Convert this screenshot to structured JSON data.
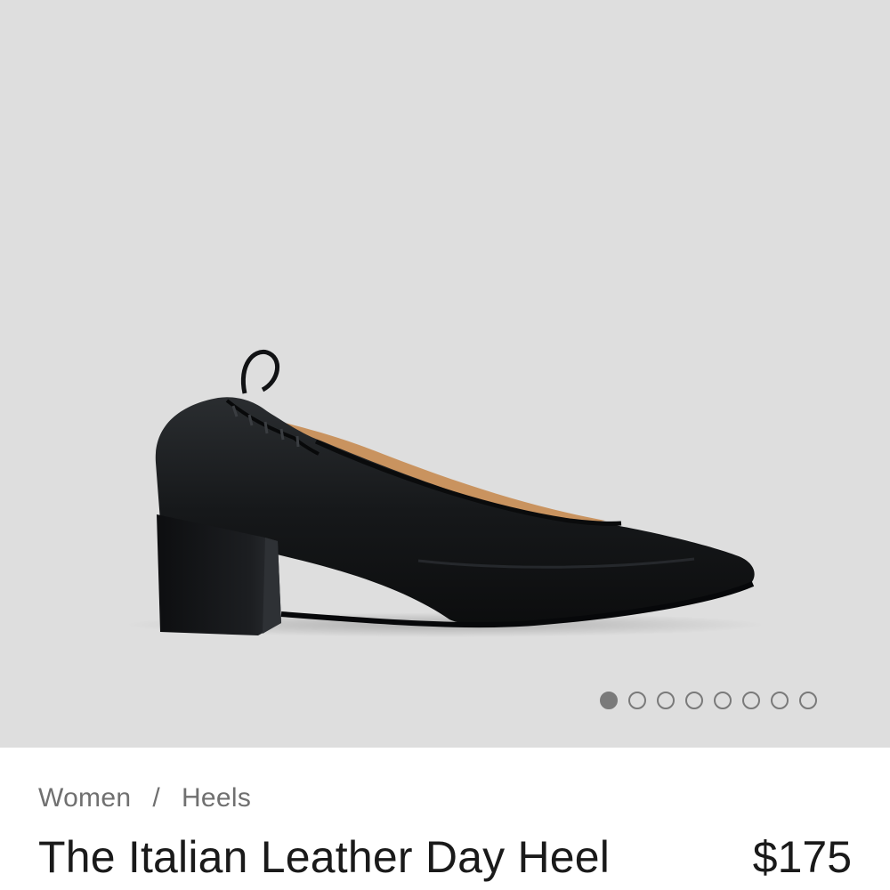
{
  "product_gallery": {
    "image_description": "black leather block heel pump",
    "image_count": 8,
    "active_index": 0
  },
  "breadcrumb": {
    "items": [
      "Women",
      "Heels"
    ],
    "separator": "/"
  },
  "product": {
    "title": "The Italian Leather Day Heel",
    "price": "$175"
  },
  "colors": {
    "gallery_bg": "#dedede",
    "shoe_leather": "#151719",
    "lining": "#c9935f",
    "dot": "#7a7a7a",
    "breadcrumb_text": "#707070",
    "title_text": "#1a1a1a"
  }
}
